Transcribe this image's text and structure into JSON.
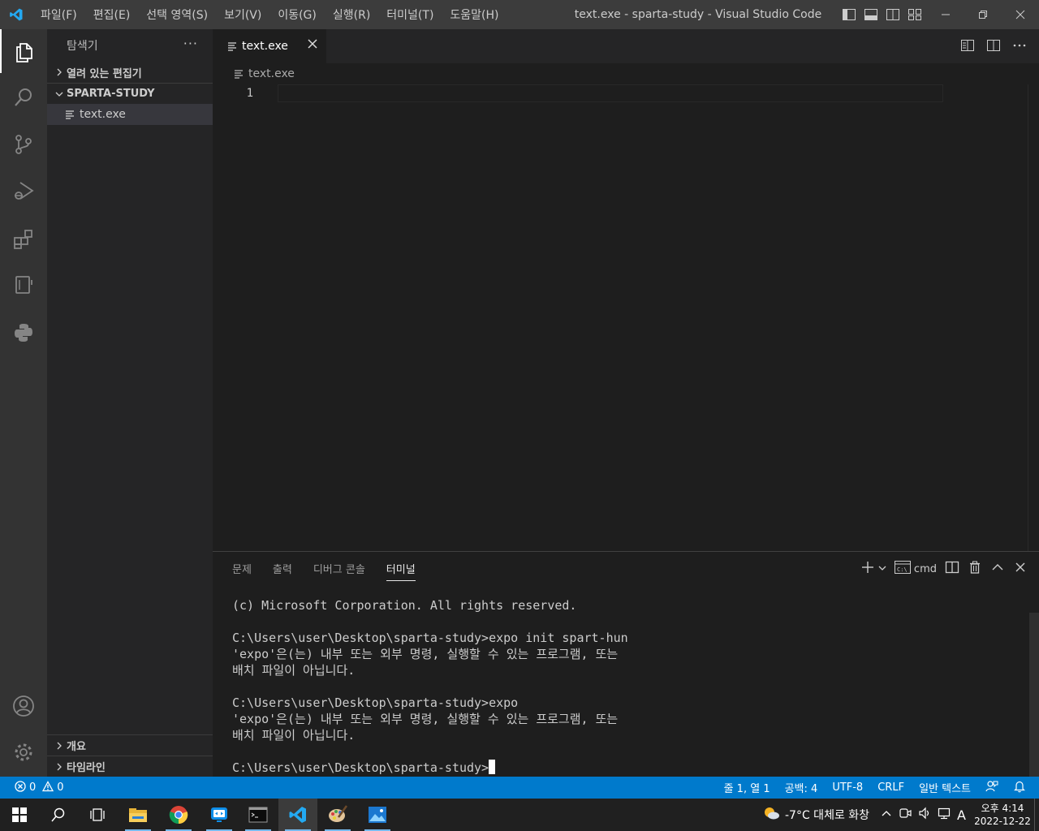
{
  "titlebar": {
    "menu": [
      "파일(F)",
      "편집(E)",
      "선택 영역(S)",
      "보기(V)",
      "이동(G)",
      "실행(R)",
      "터미널(T)",
      "도움말(H)"
    ],
    "title": "text.exe - sparta-study - Visual Studio Code"
  },
  "activitybar": {
    "icons": [
      "explorer-icon",
      "search-icon",
      "source-control-icon",
      "run-debug-icon",
      "extensions-icon",
      "remote-explorer-icon",
      "python-icon",
      "account-icon",
      "settings-gear-icon"
    ]
  },
  "sidebar": {
    "title": "탐색기",
    "more": "···",
    "open_editors": "열려 있는 편집기",
    "folder": "SPARTA-STUDY",
    "files": [
      "text.exe"
    ],
    "outline": "개요",
    "timeline": "타임라인"
  },
  "editor": {
    "tab_label": "text.exe",
    "breadcrumb": "text.exe",
    "line_number": "1"
  },
  "panel": {
    "tabs": [
      "문제",
      "출력",
      "디버그 콘솔",
      "터미널"
    ],
    "active_tab": "터미널",
    "shell": "cmd",
    "terminal_lines": [
      "(c) Microsoft Corporation. All rights reserved.",
      "",
      "C:\\Users\\user\\Desktop\\sparta-study>expo init spart-hun",
      "'expo'은(는) 내부 또는 외부 명령, 실행할 수 있는 프로그램, 또는",
      "배치 파일이 아닙니다.",
      "",
      "C:\\Users\\user\\Desktop\\sparta-study>expo",
      "'expo'은(는) 내부 또는 외부 명령, 실행할 수 있는 프로그램, 또는",
      "배치 파일이 아닙니다.",
      ""
    ],
    "prompt": "C:\\Users\\user\\Desktop\\sparta-study>"
  },
  "statusbar": {
    "errors": "0",
    "warnings": "0",
    "position": "줄 1, 열 1",
    "spaces": "공백: 4",
    "encoding": "UTF-8",
    "eol": "CRLF",
    "language": "일반 텍스트"
  },
  "taskbar": {
    "weather": "-7°C  대체로 화창",
    "ime": "A",
    "time": "오후 4:14",
    "date": "2022-12-22"
  },
  "colors": {
    "accent": "#007acc",
    "titlebar": "#3c3c3c",
    "activitybar": "#333333",
    "sidebar": "#252526",
    "editor": "#1e1e1e"
  }
}
